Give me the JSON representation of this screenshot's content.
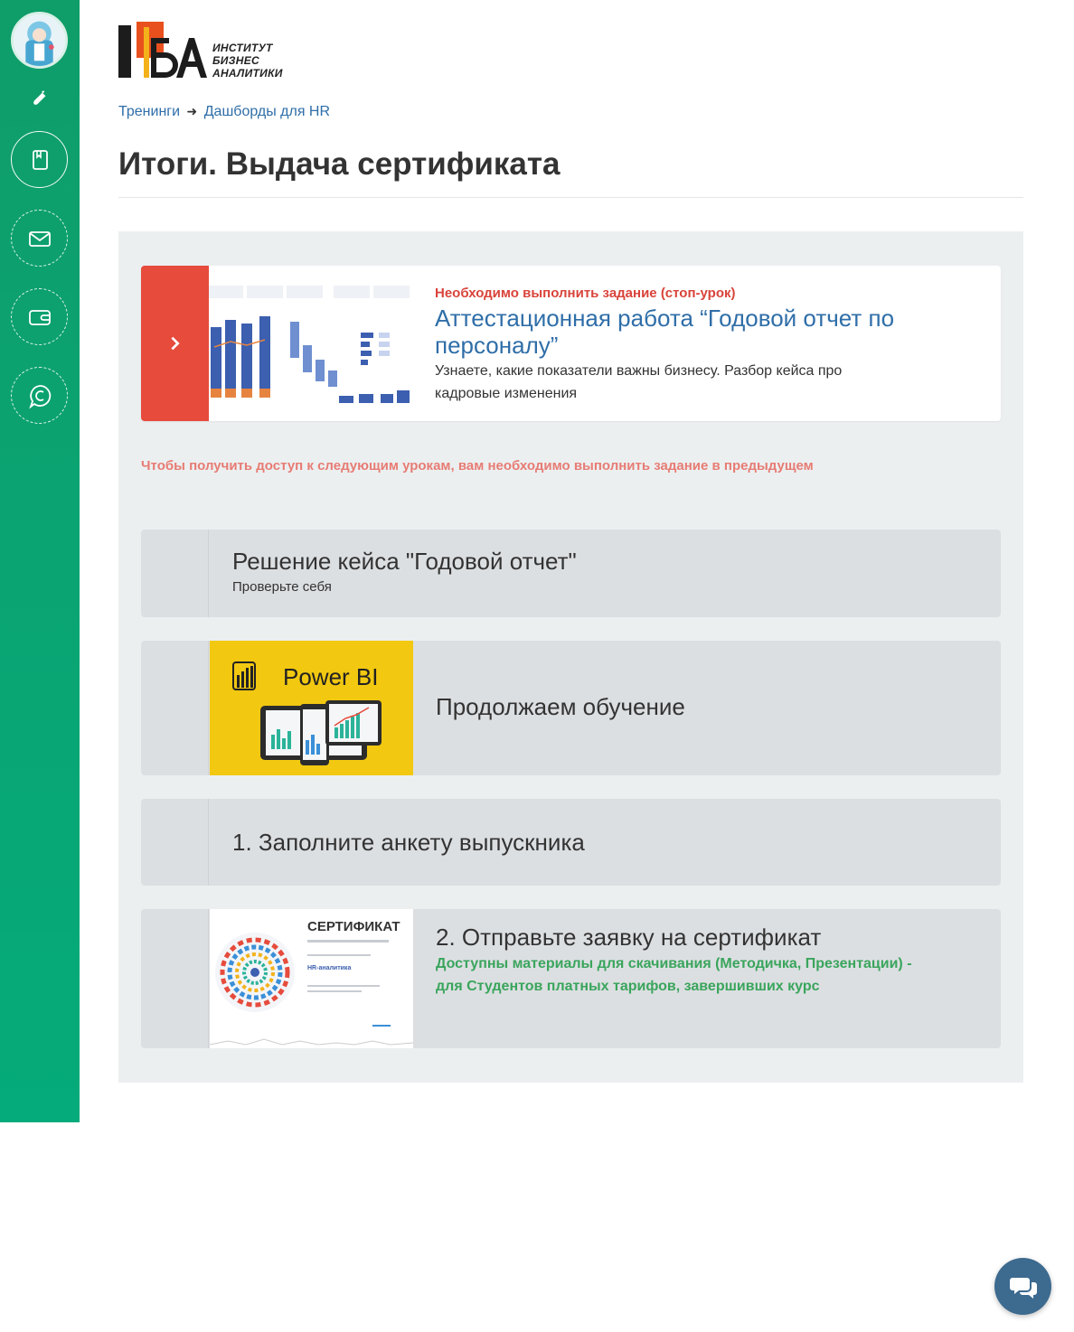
{
  "colors": {
    "sidebar": "#0f9d6a",
    "accent_red": "#e64b3c",
    "link_blue": "#2f6ea8",
    "notice_red": "#e77c74",
    "green_text": "#3aa55c",
    "panel_bg": "#eceff0",
    "locked_card_bg": "#dcdfe2",
    "chat_button": "#3d6a8f",
    "powerbi_yellow": "#f2c811"
  },
  "sidebar": {
    "icons": [
      "avatar",
      "bell-icon",
      "book-icon",
      "mail-icon",
      "wallet-icon",
      "chat-c-icon"
    ]
  },
  "logo": {
    "line1": "ИНСТИТУТ",
    "line2": "БИЗНЕС",
    "line3": "АНАЛИТИКИ",
    "mark": "БА"
  },
  "breadcrumb": {
    "item1": "Тренинги",
    "separator": "➜",
    "item2": "Дашборды для HR"
  },
  "page": {
    "title": "Итоги. Выдача сертификата"
  },
  "active_lesson": {
    "warning": "Необходимо выполнить задание (стоп-урок)",
    "title": "Аттестационная работа “Годовой отчет по персоналу”",
    "description": "Узнаете, какие показатели важны бизнесу. Разбор кейса про кадровые изменения",
    "arrow_icon": "chevron-right-icon"
  },
  "notice": "Чтобы получить доступ к следующим урокам, вам необходимо выполнить задание в предыдущем",
  "lessons": [
    {
      "title": "Решение кейса \"Годовой отчет\"",
      "subtitle": "Проверьте себя"
    },
    {
      "title": "Продолжаем обучение",
      "image_text": "Power BI"
    },
    {
      "title": "1. Заполните анкету выпускника"
    },
    {
      "title": "2. Отправьте заявку на сертификат",
      "note": "Доступны материалы для скачивания (Методичка, Презентации) - для Студентов платных тарифов, завершивших курс",
      "image_title": "СЕРТИФИКАТ",
      "image_course": "HR-аналитика"
    }
  ],
  "chat_button_icon": "chat-bubbles-icon"
}
